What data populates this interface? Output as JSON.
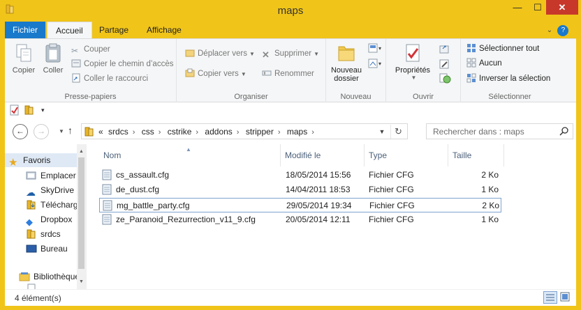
{
  "window": {
    "title": "maps",
    "minimize_label": "—",
    "maximize_label": "☐",
    "close_label": "✕"
  },
  "ribbon_tabs": {
    "file": "Fichier",
    "home": "Accueil",
    "share": "Partage",
    "view": "Affichage"
  },
  "ribbon": {
    "clipboard": {
      "label": "Presse-papiers",
      "copy": "Copier",
      "paste": "Coller",
      "cut": "Couper",
      "copy_path": "Copier le chemin d’accès",
      "paste_shortcut": "Coller le raccourci"
    },
    "organize": {
      "label": "Organiser",
      "move_to": "Déplacer vers",
      "copy_to": "Copier vers",
      "delete": "Supprimer",
      "rename": "Renommer"
    },
    "new": {
      "label": "Nouveau",
      "new_folder_line1": "Nouveau",
      "new_folder_line2": "dossier"
    },
    "open": {
      "label": "Ouvrir",
      "properties": "Propriétés"
    },
    "select": {
      "label": "Sélectionner",
      "select_all": "Sélectionner tout",
      "select_none": "Aucun",
      "invert": "Inverser la sélection"
    }
  },
  "address": {
    "prefix": "«",
    "crumbs": [
      "srdcs",
      "css",
      "cstrike",
      "addons",
      "stripper",
      "maps"
    ],
    "search_placeholder": "Rechercher dans : maps"
  },
  "nav": {
    "favorites": "Favoris",
    "items": [
      "Emplacer",
      "SkyDrive",
      "Téléchargements",
      "Dropbox",
      "srdcs",
      "Bureau"
    ],
    "libraries": "Bibliothèques"
  },
  "columns": {
    "name": "Nom",
    "modified": "Modifié le",
    "type": "Type",
    "size": "Taille"
  },
  "files": [
    {
      "name": "cs_assault.cfg",
      "modified": "18/05/2014 15:56",
      "type": "Fichier CFG",
      "size": "2 Ko"
    },
    {
      "name": "de_dust.cfg",
      "modified": "14/04/2011 18:53",
      "type": "Fichier CFG",
      "size": "1 Ko"
    },
    {
      "name": "mg_battle_party.cfg",
      "modified": "29/05/2014 19:34",
      "type": "Fichier CFG",
      "size": "2 Ko"
    },
    {
      "name": "ze_Paranoid_Rezurrection_v11_9.cfg",
      "modified": "20/05/2014 12:11",
      "type": "Fichier CFG",
      "size": "1 Ko"
    }
  ],
  "status": {
    "count": "4 élément(s)"
  },
  "colors": {
    "frame": "#f0c419",
    "accent": "#1979ca",
    "selection_border": "#7da2ce"
  }
}
